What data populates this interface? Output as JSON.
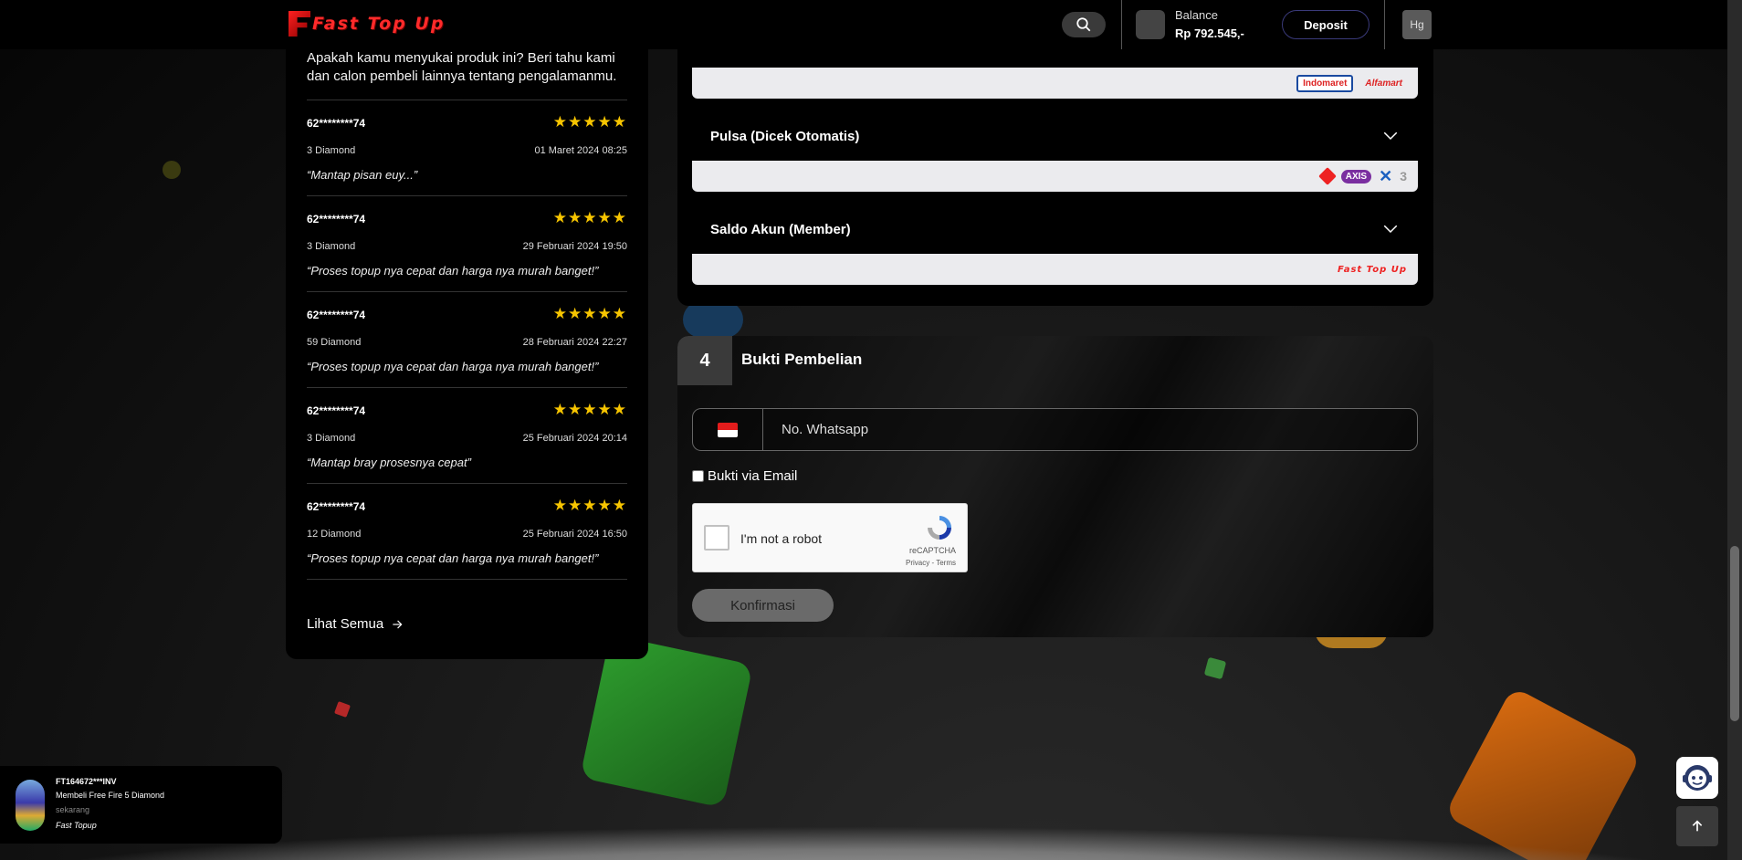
{
  "header": {
    "logo_text": "Fast Top Up",
    "balance_label": "Balance",
    "balance_value": "Rp 792.545,-",
    "deposit_label": "Deposit",
    "avatar_initials": "Hg"
  },
  "reviews": {
    "intro": "Apakah kamu menyukai produk ini? Beri tahu kami dan calon pembeli lainnya tentang pengalamanmu.",
    "items": [
      {
        "user": "62********74",
        "stars": "★★★★★",
        "product": "3 Diamond",
        "date": "01 Maret 2024 08:25",
        "text": "“Mantap pisan euy...”"
      },
      {
        "user": "62********74",
        "stars": "★★★★★",
        "product": "3 Diamond",
        "date": "29 Februari 2024 19:50",
        "text": "“Proses topup nya cepat dan harga nya murah banget!”"
      },
      {
        "user": "62********74",
        "stars": "★★★★★",
        "product": "59 Diamond",
        "date": "28 Februari 2024 22:27",
        "text": "“Proses topup nya cepat dan harga nya murah banget!”"
      },
      {
        "user": "62********74",
        "stars": "★★★★★",
        "product": "3 Diamond",
        "date": "25 Februari 2024 20:14",
        "text": "“Mantap bray prosesnya cepat”"
      },
      {
        "user": "62********74",
        "stars": "★★★★★",
        "product": "12 Diamond",
        "date": "25 Februari 2024 16:50",
        "text": "“Proses topup nya cepat dan harga nya murah banget!”"
      }
    ],
    "see_all": "Lihat Semua"
  },
  "payment": {
    "strip1_logos": [
      "Indomaret",
      "Alfamart"
    ],
    "pulsa_title": "Pulsa (Dicek Otomatis)",
    "pulsa_logos": [
      "AXIS"
    ],
    "saldo_title": "Saldo Akun (Member)",
    "saldo_logo": "Fast Top Up"
  },
  "bukti": {
    "step_number": "4",
    "title": "Bukti Pembelian",
    "whatsapp_placeholder": "No. Whatsapp",
    "email_label": "Bukti via Email",
    "captcha_label": "I'm not a robot",
    "captcha_brand": "reCAPTCHA",
    "captcha_links": "Privacy - Terms",
    "confirm_label": "Konfirmasi"
  },
  "toast": {
    "order_id": "FT164672***INV",
    "message": "Membeli Free Fire 5 Diamond",
    "time": "sekarang",
    "source": "Fast Topup"
  },
  "colors": {
    "accent_red": "#ff2a2a",
    "star": "#f7c500",
    "panel_bg": "#000000"
  }
}
